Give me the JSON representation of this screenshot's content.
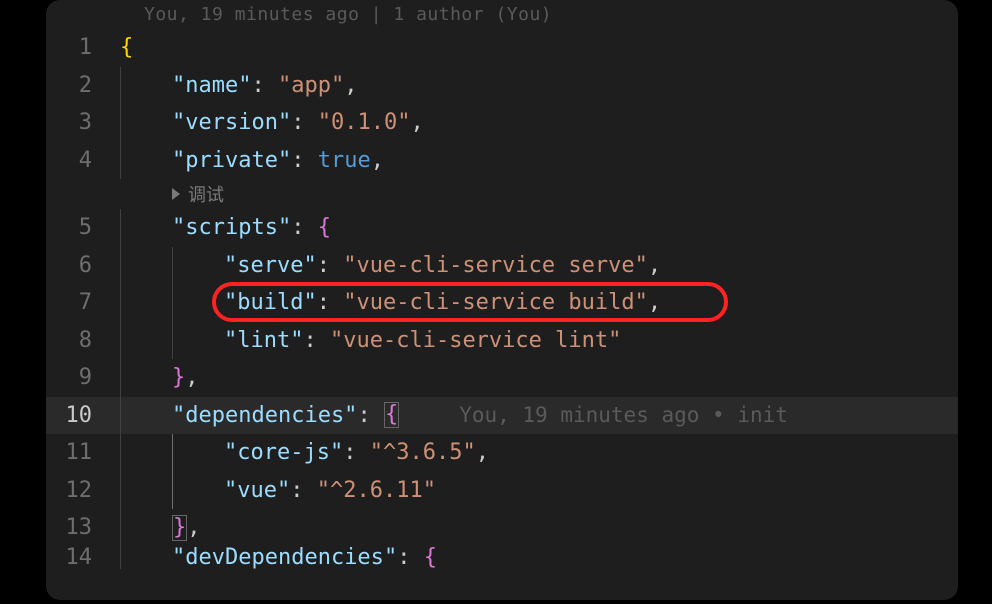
{
  "topAnnotation": "You, 19 minutes ago | 1 author (You)",
  "codeLens": "调试",
  "gitBlame": "You, 19 minutes ago • init",
  "highlight": {
    "line": 7
  },
  "currentLine": 10,
  "json": {
    "name": "app",
    "version": "0.1.0",
    "private": true,
    "scripts": {
      "serve": "vue-cli-service serve",
      "build": "vue-cli-service build",
      "lint": "vue-cli-service lint"
    },
    "dependencies": {
      "core-js": "^3.6.5",
      "vue": "^2.6.11"
    },
    "devDependenciesKey": "devDependencies"
  },
  "lineNumbers": [
    "1",
    "2",
    "3",
    "4",
    "5",
    "6",
    "7",
    "8",
    "9",
    "10",
    "11",
    "12",
    "13",
    "14"
  ]
}
